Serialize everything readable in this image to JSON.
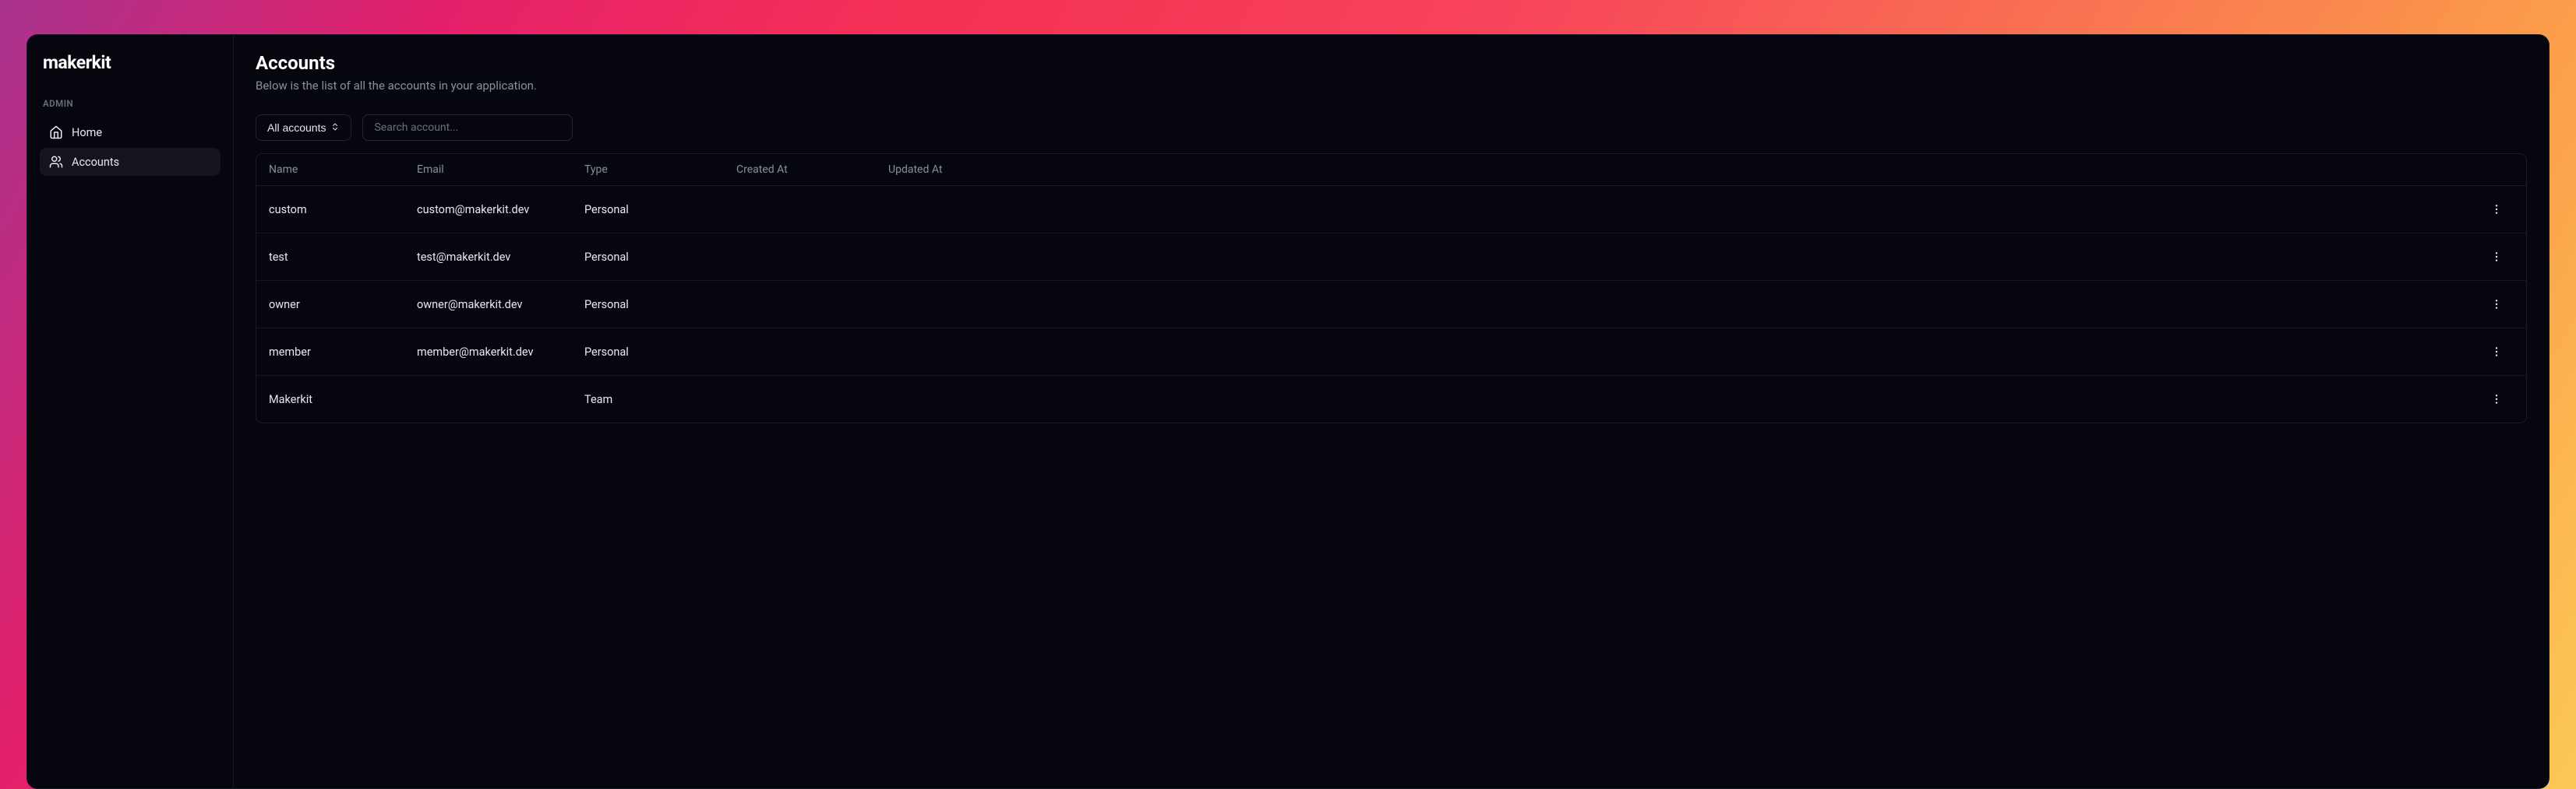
{
  "logo": "makerkit",
  "sidebar": {
    "section_label": "ADMIN",
    "items": [
      {
        "label": "Home",
        "icon": "home",
        "active": false
      },
      {
        "label": "Accounts",
        "icon": "users",
        "active": true
      }
    ]
  },
  "page": {
    "title": "Accounts",
    "subtitle": "Below is the list of all the accounts in your application."
  },
  "filter": {
    "label": "All accounts"
  },
  "search": {
    "placeholder": "Search account..."
  },
  "table": {
    "columns": [
      "Name",
      "Email",
      "Type",
      "Created At",
      "Updated At"
    ],
    "rows": [
      {
        "name": "custom",
        "email": "custom@makerkit.dev",
        "type": "Personal",
        "created_at": "",
        "updated_at": ""
      },
      {
        "name": "test",
        "email": "test@makerkit.dev",
        "type": "Personal",
        "created_at": "",
        "updated_at": ""
      },
      {
        "name": "owner",
        "email": "owner@makerkit.dev",
        "type": "Personal",
        "created_at": "",
        "updated_at": ""
      },
      {
        "name": "member",
        "email": "member@makerkit.dev",
        "type": "Personal",
        "created_at": "",
        "updated_at": ""
      },
      {
        "name": "Makerkit",
        "email": "",
        "type": "Team",
        "created_at": "",
        "updated_at": ""
      }
    ]
  }
}
